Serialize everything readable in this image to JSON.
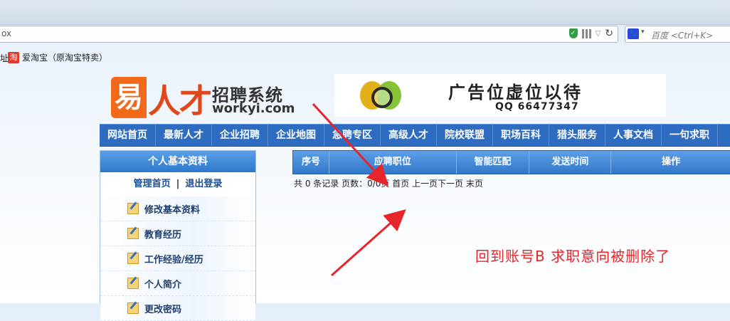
{
  "browser": {
    "url_fragment": "ox",
    "search_placeholder": "百度 <Ctrl+K>",
    "search_engine_icon": "baidu-paw-icon",
    "bookmark_truncated": "址",
    "bookmark_label": "爱淘宝（原淘宝特卖）",
    "bookmark_icon_text": "淘"
  },
  "logo": {
    "mark": "易",
    "ren": "人才",
    "title": "招聘系统",
    "url": "workyi.com"
  },
  "ad": {
    "title": "广告位虚位以待",
    "qq": "QQ 66477347"
  },
  "nav": {
    "items": [
      "网站首页",
      "最新人才",
      "企业招聘",
      "企业地图",
      "急聘专区",
      "高级人才",
      "院校联盟",
      "职场百科",
      "猎头服务",
      "人事文档",
      "一句求职"
    ]
  },
  "sidebar": {
    "header": "个人基本资料",
    "manage_home": "管理首页",
    "separator": "|",
    "logout": "退出登录",
    "items": [
      "修改基本资料",
      "教育经历",
      "工作经验/经历",
      "个人简介",
      "更改密码"
    ]
  },
  "table": {
    "headers": [
      "序号",
      "应聘职位",
      "智能匹配",
      "发送时间",
      "操作"
    ]
  },
  "pager": {
    "text": "共 0 条记录 页数：0/0页 首页 上一页下一页 末页"
  },
  "annotation": {
    "note": "回到账号B 求职意向被删除了",
    "color": "#e6262a"
  },
  "colors": {
    "nav_bg": "#2d6cc0",
    "brand_orange": "#f06a1a",
    "table_head": "#3378c9"
  }
}
